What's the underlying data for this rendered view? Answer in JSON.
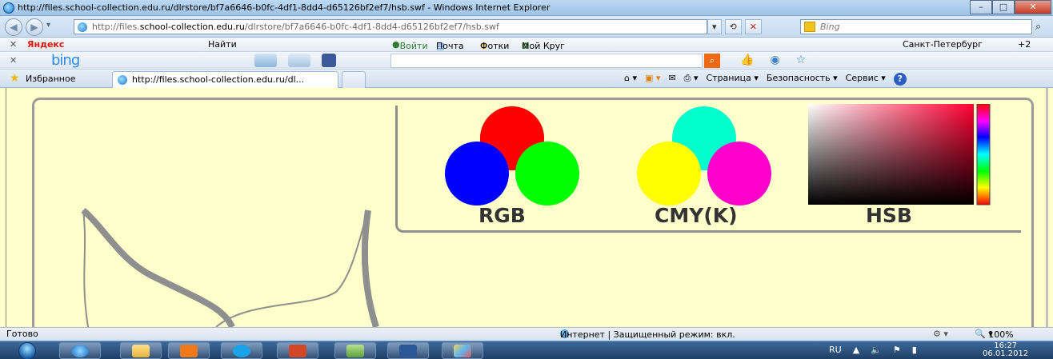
{
  "window": {
    "title": "http://files.school-collection.edu.ru/dlrstore/bf7a6646-b0fc-4df1-8dd4-d65126bf2ef7/hsb.swf - Windows Internet Explorer",
    "minimize": "–",
    "maximize": "□",
    "close": "✕"
  },
  "address": {
    "url_prefix": "http://files.",
    "url_domain": "school-collection.edu.ru",
    "url_path": "/dlrstore/bf7a6646-b0fc-4df1-8dd4-d65126bf2ef7/hsb.swf",
    "back_glyph": "◀",
    "forward_glyph": "▶",
    "compat_glyph": "▾",
    "refresh_glyph": "⟲",
    "stop_glyph": "✕",
    "search_placeholder": "Bing",
    "search_glyph": "⌕"
  },
  "yandex_toolbar": {
    "close": "✕",
    "yandex": "Яндекс",
    "find": "Найти",
    "login": "Войти",
    "mail": "Почта",
    "photos": "Фотки",
    "my_circle": "Мой Круг",
    "weather": "Санкт-Петербург",
    "temperature": "+2"
  },
  "bing_toolbar": {
    "close": "✕",
    "logo": "bing",
    "search_glyph": "⌕"
  },
  "favorites_bar": {
    "favorites": "Избранное",
    "tab_title": "http://files.school-collection.edu.ru/dl...",
    "page_menu": "Страница",
    "safety_menu": "Безопасность",
    "tools_menu": "Сервис",
    "help": "?"
  },
  "flash_content": {
    "models": [
      {
        "name": "RGB"
      },
      {
        "name": "CMY(K)"
      },
      {
        "name": "HSB"
      }
    ]
  },
  "statusbar": {
    "status": "Готово",
    "zone": "Интернет | Защищенный режим: вкл.",
    "zoom": "100%"
  },
  "taskbar": {
    "language": "RU",
    "time": "16:27",
    "date": "06.01.2012"
  },
  "colors": {
    "content_bg": "#ffffcc",
    "red": "#ff0000",
    "green": "#00ff00",
    "blue": "#0000ff",
    "cyan": "#00ffff",
    "magenta": "#ff00ff",
    "yellow": "#ffff00"
  }
}
